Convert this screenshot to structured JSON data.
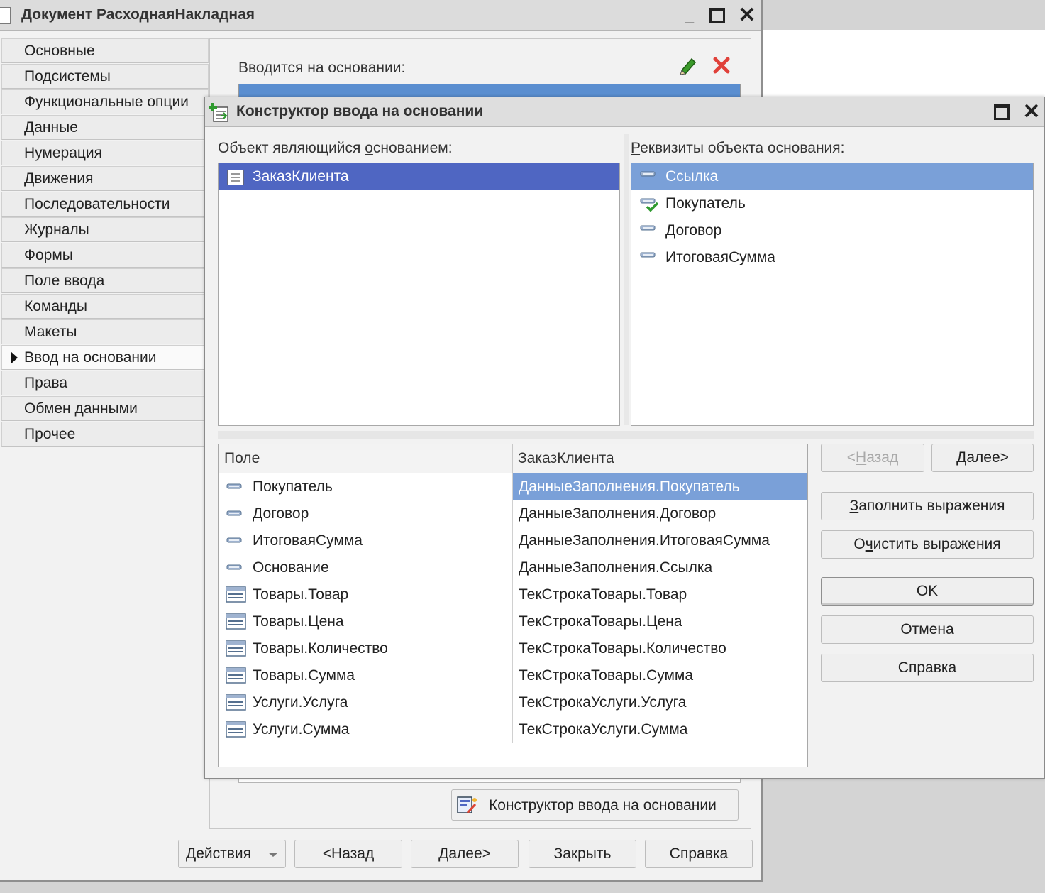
{
  "outer_window": {
    "title": "Документ РасходнаяНакладная",
    "nav_items": [
      {
        "label": "Основные"
      },
      {
        "label": "Подсистемы"
      },
      {
        "label": "Функциональные опции"
      },
      {
        "label": "Данные"
      },
      {
        "label": "Нумерация"
      },
      {
        "label": "Движения"
      },
      {
        "label": "Последовательности"
      },
      {
        "label": "Журналы"
      },
      {
        "label": "Формы"
      },
      {
        "label": "Поле ввода"
      },
      {
        "label": "Команды"
      },
      {
        "label": "Макеты"
      },
      {
        "label": "Ввод на основании",
        "active": true
      },
      {
        "label": "Права"
      },
      {
        "label": "Обмен данными"
      },
      {
        "label": "Прочее"
      }
    ],
    "based_on_label": "Вводится на основании:",
    "constructor_button": "Конструктор ввода на основании",
    "bottom_buttons": {
      "actions": "Действия",
      "back": "<Назад",
      "next": "Далее>",
      "close": "Закрыть",
      "help": "Справка"
    }
  },
  "dialog": {
    "title": "Конструктор ввода на основании",
    "object_label": "Объект являющийся основанием:",
    "object_label_parts": [
      "Объект являющийся ",
      "о",
      "снованием:"
    ],
    "attributes_label_parts": [
      "Р",
      "еквизиты объекта основания:"
    ],
    "objects": [
      "ЗаказКлиента"
    ],
    "attributes": [
      "Ссылка",
      "Покупатель",
      "Договор",
      "ИтоговаяСумма"
    ],
    "grid": {
      "col_field": "Поле",
      "col_source": "ЗаказКлиента",
      "rows": [
        {
          "field": "Покупатель",
          "expr": "ДанныеЗаполнения.Покупатель",
          "kind": "attr"
        },
        {
          "field": "Договор",
          "expr": "ДанныеЗаполнения.Договор",
          "kind": "attr"
        },
        {
          "field": "ИтоговаяСумма",
          "expr": "ДанныеЗаполнения.ИтоговаяСумма",
          "kind": "attr"
        },
        {
          "field": "Основание",
          "expr": "ДанныеЗаполнения.Ссылка",
          "kind": "attr"
        },
        {
          "field": "Товары.Товар",
          "expr": "ТекСтрокаТовары.Товар",
          "kind": "table"
        },
        {
          "field": "Товары.Цена",
          "expr": "ТекСтрокаТовары.Цена",
          "kind": "table"
        },
        {
          "field": "Товары.Количество",
          "expr": "ТекСтрокаТовары.Количество",
          "kind": "table"
        },
        {
          "field": "Товары.Сумма",
          "expr": "ТекСтрокаТовары.Сумма",
          "kind": "table"
        },
        {
          "field": "Услуги.Услуга",
          "expr": "ТекСтрокаУслуги.Услуга",
          "kind": "table"
        },
        {
          "field": "Услуги.Сумма",
          "expr": "ТекСтрокаУслуги.Сумма",
          "kind": "table"
        }
      ]
    },
    "buttons": {
      "back_parts": [
        "<",
        "Н",
        "азад"
      ],
      "next_parts": [
        "Д",
        "алее>"
      ],
      "fill_parts": [
        "З",
        "аполнить выражения"
      ],
      "clear_parts": [
        "О",
        "ч",
        "истить выражения"
      ],
      "ok": "OK",
      "cancel": "Отмена",
      "help": "Справка"
    }
  },
  "colors": {
    "selection_dark": "#4f66c2",
    "selection_light": "#7aa0d8",
    "delete_red": "#e0413a",
    "pencil_green": "#3a9a2a"
  }
}
